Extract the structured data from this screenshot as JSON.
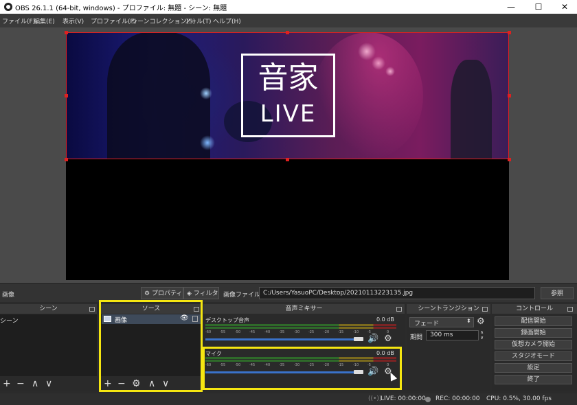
{
  "window": {
    "title": "OBS 26.1.1 (64-bit, windows) - プロファイル: 無題 - シーン: 無題",
    "minimize": "—",
    "maximize": "☐",
    "close": "✕"
  },
  "menu": [
    "ファイル(F)",
    "編集(E)",
    "表示(V)",
    "プロファイル(P)",
    "シーンコレクション(S)",
    "ツール(T)",
    "ヘルプ(H)"
  ],
  "preview": {
    "banner_kanji": "音家",
    "banner_live": "LIVE"
  },
  "properties_bar": {
    "selected_source": "画像",
    "properties_button": "プロパティ",
    "filters_button": "フィルタ",
    "image_file_label": "画像ファイル",
    "image_path": "C:/Users/YasuoPC/Desktop/20210113223135.jpg",
    "browse_button": "参照"
  },
  "scenes": {
    "header": "シーン",
    "items": [
      "シーン"
    ]
  },
  "sources": {
    "header": "ソース",
    "items": [
      {
        "name": "画像",
        "icon": "image-icon"
      }
    ]
  },
  "mixer": {
    "header": "音声ミキサー",
    "channels": [
      {
        "name": "デスクトップ音声",
        "db": "0.0 dB"
      },
      {
        "name": "マイク",
        "db": "0.0 dB"
      }
    ],
    "ticks": [
      "-60",
      "-55",
      "-50",
      "-45",
      "-40",
      "-35",
      "-30",
      "-25",
      "-20",
      "-15",
      "-10",
      "-5",
      "0"
    ]
  },
  "transitions": {
    "header": "シーントランジション",
    "type": "フェード",
    "duration_label": "期間",
    "duration_value": "300 ms"
  },
  "controls": {
    "header": "コントロール",
    "buttons": [
      "配信開始",
      "録画開始",
      "仮想カメラ開始",
      "スタジオモード",
      "設定",
      "終了"
    ]
  },
  "status": {
    "live": "LIVE: 00:00:00",
    "rec": "REC: 00:00:00",
    "cpu": "CPU: 0.5%, 30.00 fps"
  },
  "colors": {
    "highlight": "#f5e611",
    "selection": "#e02020",
    "slider": "#3a72c9"
  }
}
